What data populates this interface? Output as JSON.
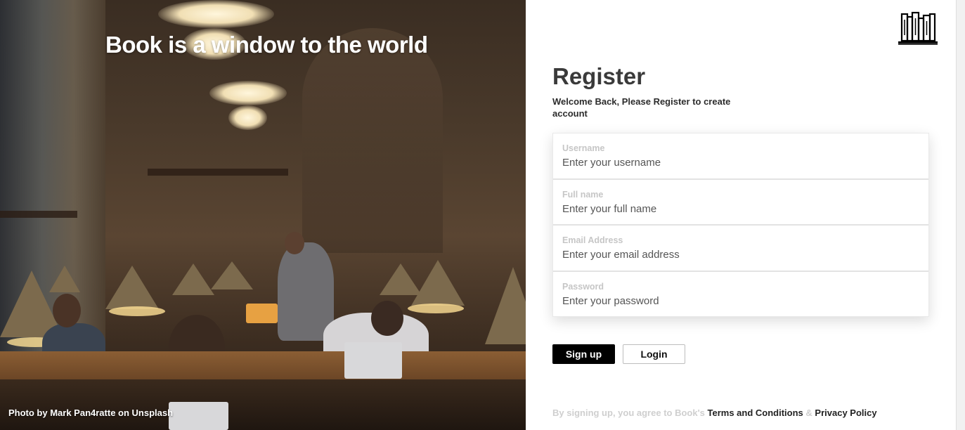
{
  "hero": {
    "title": "Book is a window to the world",
    "credit_prefix": "Photo by ",
    "credit_author": "Mark Pan4ratte",
    "credit_on": " on ",
    "credit_site": "Unsplash"
  },
  "logo": {
    "icon": "bookshelf-icon"
  },
  "register": {
    "title": "Register",
    "subtitle": "Welcome Back, Please Register to create account"
  },
  "form": {
    "fields": [
      {
        "label": "Username",
        "placeholder": "Enter your username",
        "value": ""
      },
      {
        "label": "Full name",
        "placeholder": "Enter your full name",
        "value": ""
      },
      {
        "label": "Email Address",
        "placeholder": "Enter your email address",
        "value": ""
      },
      {
        "label": "Password",
        "placeholder": "Enter your password",
        "value": ""
      }
    ]
  },
  "buttons": {
    "signup": "Sign up",
    "login": "Login"
  },
  "terms": {
    "prefix": "By signing up, you agree to Book's ",
    "terms_link": "Terms and Conditions",
    "and": " & ",
    "privacy_link": "Privacy Policy"
  },
  "colors": {
    "primary": "#000000",
    "muted_text": "#c6c6c6",
    "title_text": "#3a3a3a"
  }
}
